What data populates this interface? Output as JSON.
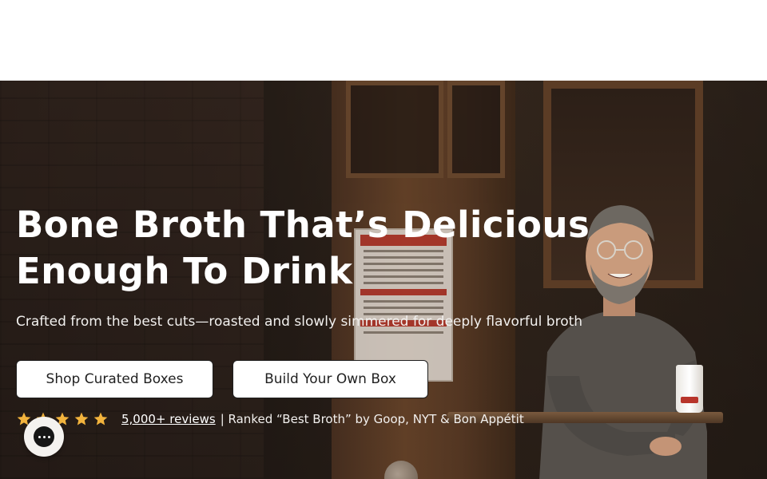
{
  "hero": {
    "headline": "Bone Broth That’s Delicious Enough To Drink",
    "subhead": "Crafted from the best cuts—roasted and slowly simmered for deeply flavorful broth",
    "buttons": {
      "shop_label": "Shop Curated Boxes",
      "build_label": "Build Your Own Box"
    },
    "rating": {
      "stars": 5,
      "reviews_link": "5,000+ reviews",
      "ranking_text": "| Ranked “Best Broth” by Goop, NYT & Bon Appétit"
    }
  },
  "colors": {
    "star": "#f2b33d",
    "button_bg": "#ffffff",
    "button_text": "#1f1f1f",
    "hero_text": "#ffffff"
  },
  "icons": {
    "rating": "star-icon",
    "chat": "chat-icon"
  }
}
